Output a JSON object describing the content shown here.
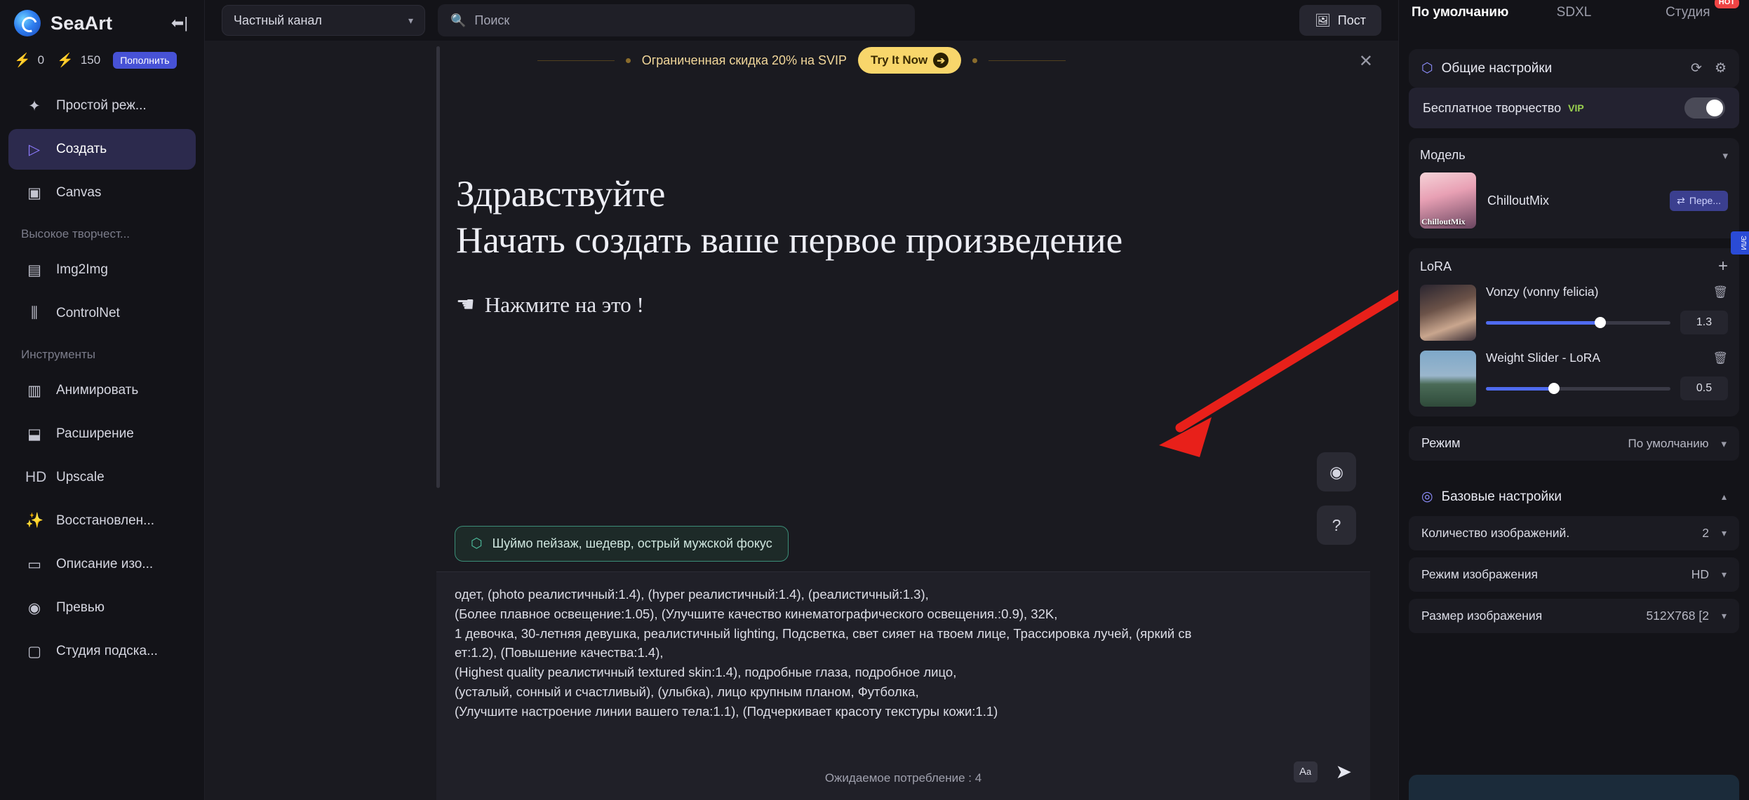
{
  "sidebar": {
    "brand": "SeaArt",
    "collapse_icon": "collapse-left-icon",
    "credits": {
      "purple_value": "0",
      "yellow_value": "150",
      "topup_label": "Пополнить"
    },
    "items": [
      {
        "label": "Простой реж...",
        "icon": "sparkles-icon",
        "active": false
      },
      {
        "label": "Создать",
        "icon": "play-icon",
        "active": true
      },
      {
        "label": "Canvas",
        "icon": "canvas-icon",
        "active": false
      }
    ],
    "section1": "Высокое творчест...",
    "items2": [
      {
        "label": "Img2Img",
        "icon": "image-icon"
      },
      {
        "label": "ControlNet",
        "icon": "sliders-icon"
      }
    ],
    "section2": "Инструменты",
    "items3": [
      {
        "label": "Анимировать",
        "icon": "film-icon"
      },
      {
        "label": "Расширение",
        "icon": "expand-icon"
      },
      {
        "label": "Upscale",
        "icon": "hd-icon"
      },
      {
        "label": "Восстановлен...",
        "icon": "magic-icon"
      },
      {
        "label": "Описание изо...",
        "icon": "book-icon"
      },
      {
        "label": "Превью",
        "icon": "eye-icon"
      },
      {
        "label": "Студия подска...",
        "icon": "studio-icon"
      }
    ]
  },
  "topbar": {
    "channel": "Частный канал",
    "search_placeholder": "Поиск",
    "post_label": "Пост"
  },
  "promo": {
    "text": "Ограниченная скидка 20% на SVIP",
    "button": "Try It Now",
    "close_icon": "close-icon"
  },
  "canvas": {
    "heading1": "Здравствуйте",
    "heading2": "Начать создать ваше первое произведение",
    "click_hint": "Нажмите на это !",
    "tag_text": "Шуймо  пейзаж, шедевр, острый мужской фокус",
    "fab_eye": "eye-icon",
    "fab_help": "?"
  },
  "prompt": {
    "lines": [
      "одет, (photo реалистичный:1.4), (hyper реалистичный:1.4), (реалистичный:1.3),",
      "(Более плавное освещение:1.05), (Улучшите качество кинематографического освещения.:0.9), 32K,",
      "1 девочка, 30-летняя девушка, реалистичный lighting, Подсветка, свет сияет на твоем лице, Трассировка лучей, (яркий св",
      "ет:1.2), (Повышение качества:1.4),",
      "(Highest quality реалистичный textured skin:1.4), подробные глаза, подробное лицо,",
      "(усталый, сонный и счастливый), (улыбка), лицо крупным планом, Футболка,",
      "(Улучшите настроение линии вашего тела:1.1), (Подчеркивает красоту текстуры кожи:1.1)"
    ],
    "consumption": "Ожидаемое потребление : 4",
    "translate_icon": "translate-icon",
    "send_icon": "send-icon"
  },
  "right": {
    "tabs": [
      {
        "label": "По умолчанию",
        "active": true,
        "hot": ""
      },
      {
        "label": "SDXL",
        "active": false,
        "hot": ""
      },
      {
        "label": "Студия",
        "active": false,
        "hot": "HOT"
      }
    ],
    "general": {
      "title": "Общие настройки",
      "refresh_icon": "refresh-icon",
      "gear_icon": "gear-icon",
      "free_label": "Бесплатное творчество",
      "vip_badge": "VIP",
      "toggle_on": true
    },
    "model": {
      "title": "Модель",
      "name": "ChilloutMix",
      "change_label": "Пере..."
    },
    "lora": {
      "title": "LoRA",
      "add_icon": "plus-icon",
      "items": [
        {
          "name": "Vonzy (vonny felicia)",
          "value": "1.3",
          "fill_pct": 62
        },
        {
          "name": "Weight Slider - LoRA",
          "value": "0.5",
          "fill_pct": 37
        }
      ]
    },
    "mode": {
      "label": "Режим",
      "value": "По умолчанию"
    },
    "basic": {
      "title": "Базовые настройки",
      "rows": [
        {
          "label": "Количество изображений.",
          "value": "2"
        },
        {
          "label": "Режим изображения",
          "value": "HD"
        },
        {
          "label": "Размер изображения",
          "value": "512X768  [2"
        }
      ]
    },
    "edge_badge": "ЭЛИ"
  }
}
